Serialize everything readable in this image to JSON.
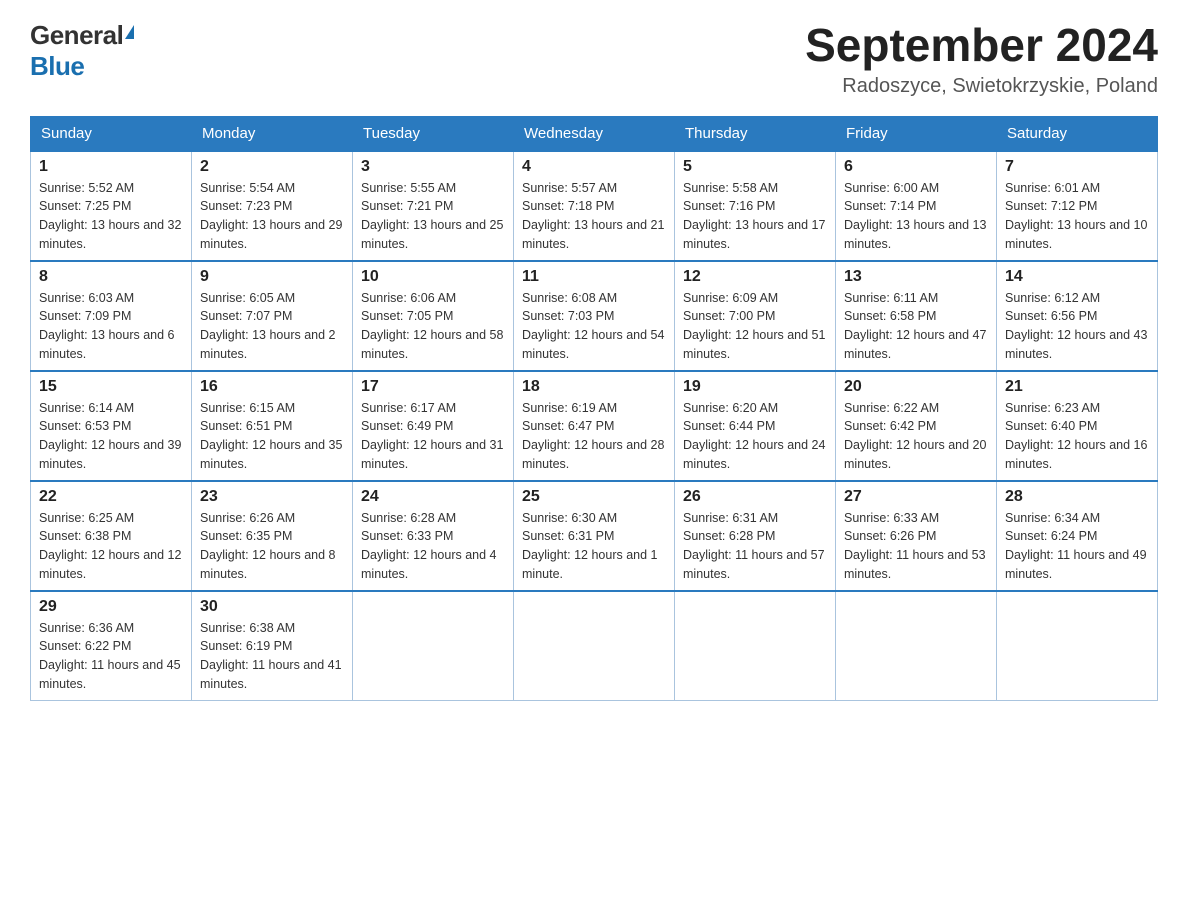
{
  "logo": {
    "general": "General",
    "blue": "Blue"
  },
  "header": {
    "month_year": "September 2024",
    "location": "Radoszyce, Swietokrzyskie, Poland"
  },
  "days_of_week": [
    "Sunday",
    "Monday",
    "Tuesday",
    "Wednesday",
    "Thursday",
    "Friday",
    "Saturday"
  ],
  "weeks": [
    [
      {
        "day": "1",
        "sunrise": "5:52 AM",
        "sunset": "7:25 PM",
        "daylight": "13 hours and 32 minutes."
      },
      {
        "day": "2",
        "sunrise": "5:54 AM",
        "sunset": "7:23 PM",
        "daylight": "13 hours and 29 minutes."
      },
      {
        "day": "3",
        "sunrise": "5:55 AM",
        "sunset": "7:21 PM",
        "daylight": "13 hours and 25 minutes."
      },
      {
        "day": "4",
        "sunrise": "5:57 AM",
        "sunset": "7:18 PM",
        "daylight": "13 hours and 21 minutes."
      },
      {
        "day": "5",
        "sunrise": "5:58 AM",
        "sunset": "7:16 PM",
        "daylight": "13 hours and 17 minutes."
      },
      {
        "day": "6",
        "sunrise": "6:00 AM",
        "sunset": "7:14 PM",
        "daylight": "13 hours and 13 minutes."
      },
      {
        "day": "7",
        "sunrise": "6:01 AM",
        "sunset": "7:12 PM",
        "daylight": "13 hours and 10 minutes."
      }
    ],
    [
      {
        "day": "8",
        "sunrise": "6:03 AM",
        "sunset": "7:09 PM",
        "daylight": "13 hours and 6 minutes."
      },
      {
        "day": "9",
        "sunrise": "6:05 AM",
        "sunset": "7:07 PM",
        "daylight": "13 hours and 2 minutes."
      },
      {
        "day": "10",
        "sunrise": "6:06 AM",
        "sunset": "7:05 PM",
        "daylight": "12 hours and 58 minutes."
      },
      {
        "day": "11",
        "sunrise": "6:08 AM",
        "sunset": "7:03 PM",
        "daylight": "12 hours and 54 minutes."
      },
      {
        "day": "12",
        "sunrise": "6:09 AM",
        "sunset": "7:00 PM",
        "daylight": "12 hours and 51 minutes."
      },
      {
        "day": "13",
        "sunrise": "6:11 AM",
        "sunset": "6:58 PM",
        "daylight": "12 hours and 47 minutes."
      },
      {
        "day": "14",
        "sunrise": "6:12 AM",
        "sunset": "6:56 PM",
        "daylight": "12 hours and 43 minutes."
      }
    ],
    [
      {
        "day": "15",
        "sunrise": "6:14 AM",
        "sunset": "6:53 PM",
        "daylight": "12 hours and 39 minutes."
      },
      {
        "day": "16",
        "sunrise": "6:15 AM",
        "sunset": "6:51 PM",
        "daylight": "12 hours and 35 minutes."
      },
      {
        "day": "17",
        "sunrise": "6:17 AM",
        "sunset": "6:49 PM",
        "daylight": "12 hours and 31 minutes."
      },
      {
        "day": "18",
        "sunrise": "6:19 AM",
        "sunset": "6:47 PM",
        "daylight": "12 hours and 28 minutes."
      },
      {
        "day": "19",
        "sunrise": "6:20 AM",
        "sunset": "6:44 PM",
        "daylight": "12 hours and 24 minutes."
      },
      {
        "day": "20",
        "sunrise": "6:22 AM",
        "sunset": "6:42 PM",
        "daylight": "12 hours and 20 minutes."
      },
      {
        "day": "21",
        "sunrise": "6:23 AM",
        "sunset": "6:40 PM",
        "daylight": "12 hours and 16 minutes."
      }
    ],
    [
      {
        "day": "22",
        "sunrise": "6:25 AM",
        "sunset": "6:38 PM",
        "daylight": "12 hours and 12 minutes."
      },
      {
        "day": "23",
        "sunrise": "6:26 AM",
        "sunset": "6:35 PM",
        "daylight": "12 hours and 8 minutes."
      },
      {
        "day": "24",
        "sunrise": "6:28 AM",
        "sunset": "6:33 PM",
        "daylight": "12 hours and 4 minutes."
      },
      {
        "day": "25",
        "sunrise": "6:30 AM",
        "sunset": "6:31 PM",
        "daylight": "12 hours and 1 minute."
      },
      {
        "day": "26",
        "sunrise": "6:31 AM",
        "sunset": "6:28 PM",
        "daylight": "11 hours and 57 minutes."
      },
      {
        "day": "27",
        "sunrise": "6:33 AM",
        "sunset": "6:26 PM",
        "daylight": "11 hours and 53 minutes."
      },
      {
        "day": "28",
        "sunrise": "6:34 AM",
        "sunset": "6:24 PM",
        "daylight": "11 hours and 49 minutes."
      }
    ],
    [
      {
        "day": "29",
        "sunrise": "6:36 AM",
        "sunset": "6:22 PM",
        "daylight": "11 hours and 45 minutes."
      },
      {
        "day": "30",
        "sunrise": "6:38 AM",
        "sunset": "6:19 PM",
        "daylight": "11 hours and 41 minutes."
      },
      null,
      null,
      null,
      null,
      null
    ]
  ]
}
